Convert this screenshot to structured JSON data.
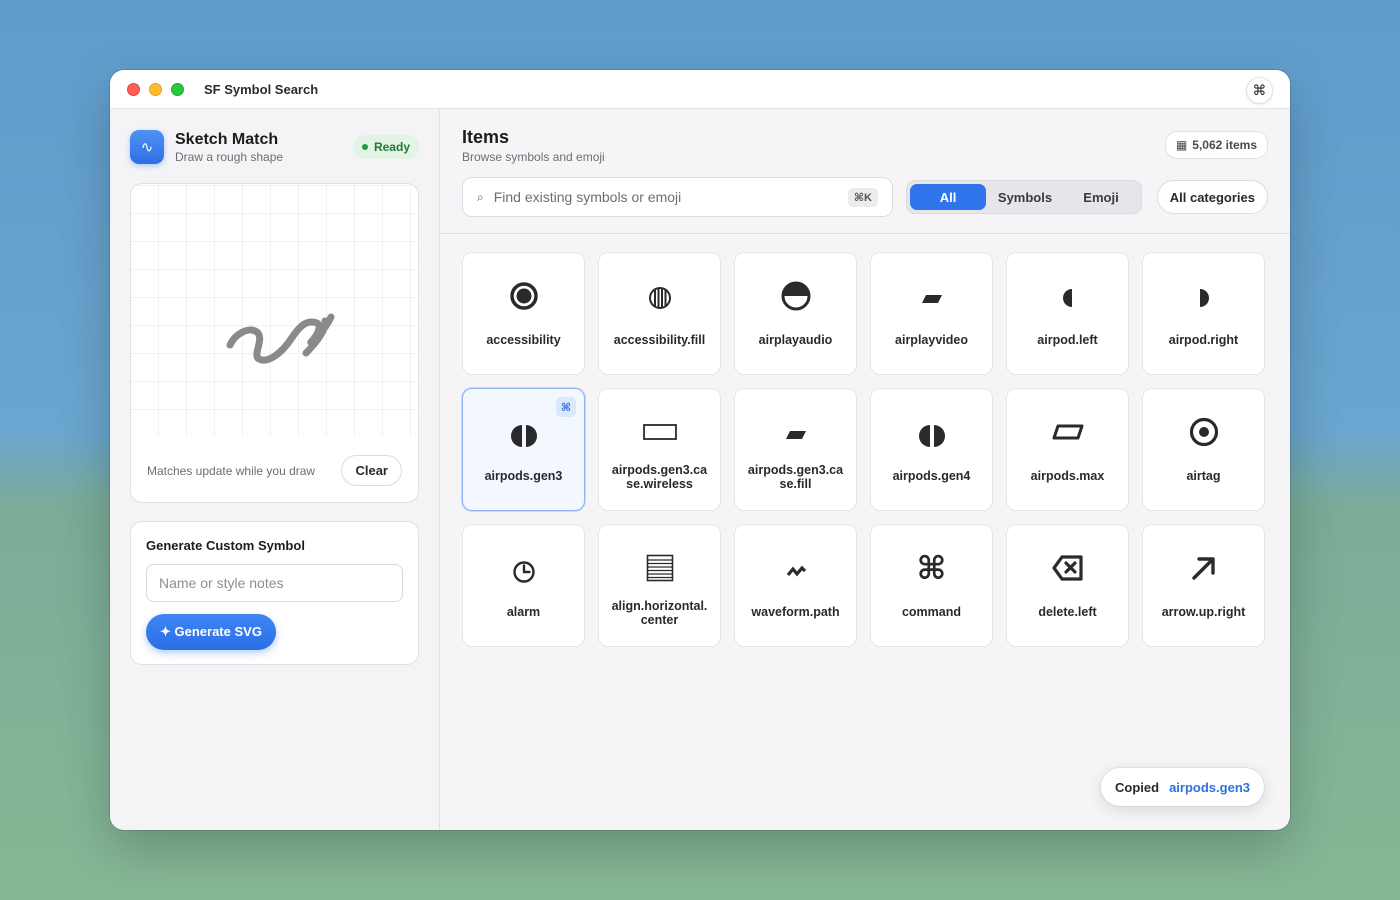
{
  "window": {
    "title": "SF Symbol Search",
    "command_glyph": "⌘"
  },
  "sidebar": {
    "sketch": {
      "icon_glyph": "∿",
      "title": "Sketch Match",
      "subtitle": "Draw a rough shape",
      "status": "Ready",
      "hint": "Matches update while you draw",
      "clear_label": "Clear"
    },
    "generate": {
      "title": "Generate Custom Symbol",
      "input_placeholder": "Name or style notes",
      "input_value": "",
      "button_label": "✦ Generate SVG"
    }
  },
  "main": {
    "title": "Items",
    "subtitle": "Browse symbols and emoji",
    "count_label": "5,062 items",
    "count_icon": "▦",
    "search": {
      "placeholder": "Find existing symbols or emoji",
      "value": "",
      "shortcut": "⌘K",
      "icon": "⌕"
    },
    "filters": [
      {
        "label": "All",
        "active": true
      },
      {
        "label": "Symbols",
        "active": false
      },
      {
        "label": "Emoji",
        "active": false
      }
    ],
    "category_label": "All categories",
    "items": [
      {
        "name": "accessibility",
        "icon": "ring-icon"
      },
      {
        "name": "accessibility.fill",
        "icon": "striped-circle-icon"
      },
      {
        "name": "airplayaudio",
        "icon": "half-circle-icon"
      },
      {
        "name": "airplayvideo",
        "icon": "parallelogram-fill-icon"
      },
      {
        "name": "airpod.left",
        "icon": "left-half-icon"
      },
      {
        "name": "airpod.right",
        "icon": "right-half-icon"
      },
      {
        "name": "airpods.gen3",
        "icon": "split-circle-icon",
        "selected": true,
        "badge": "⌘"
      },
      {
        "name": "airpods.gen3.case.wireless",
        "icon": "rectangle-outline-icon"
      },
      {
        "name": "airpods.gen3.case.fill",
        "icon": "parallelogram-fill-icon"
      },
      {
        "name": "airpods.gen4",
        "icon": "split-circle-icon"
      },
      {
        "name": "airpods.max",
        "icon": "parallelogram-outline-icon"
      },
      {
        "name": "airtag",
        "icon": "target-icon"
      },
      {
        "name": "alarm",
        "icon": "clock-icon"
      },
      {
        "name": "align.horizontal.center",
        "icon": "lines-icon"
      },
      {
        "name": "waveform.path",
        "icon": "waveform-icon"
      },
      {
        "name": "command",
        "icon": "command-icon",
        "glyph": "⌘"
      },
      {
        "name": "delete.left",
        "icon": "delete-left-icon"
      },
      {
        "name": "arrow.up.right",
        "icon": "arrow-up-right-icon"
      }
    ]
  },
  "toast": {
    "prefix": "Copied",
    "value": "airpods.gen3"
  }
}
